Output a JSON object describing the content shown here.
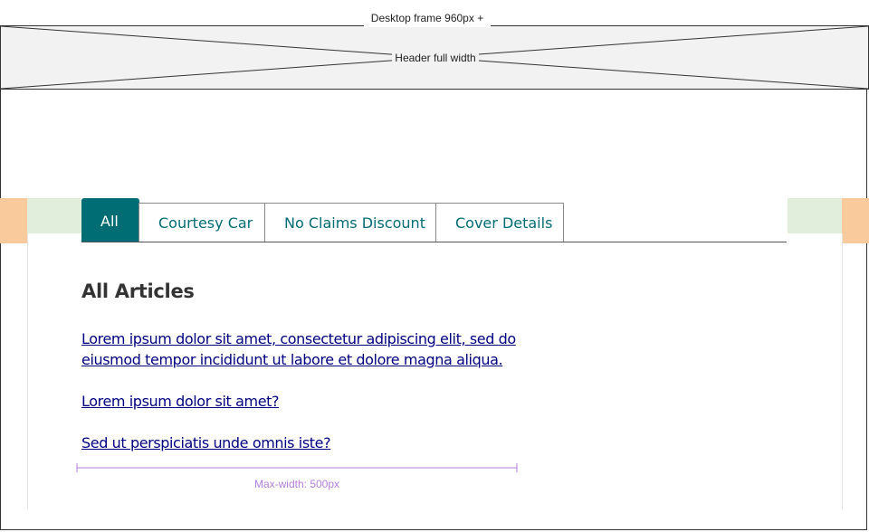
{
  "frame_label": "Desktop frame 960px +",
  "header": {
    "label": "Header full width"
  },
  "tabs": [
    {
      "label": "All",
      "active": true
    },
    {
      "label": "Courtesy Car",
      "active": false
    },
    {
      "label": "No Claims Discount",
      "active": false
    },
    {
      "label": "Cover Details",
      "active": false
    }
  ],
  "main": {
    "title": "All Articles",
    "articles": [
      {
        "text": "Lorem ipsum dolor sit amet, consectetur adipiscing elit, sed do eiusmod tempor incididunt ut labore et dolore magna aliqua."
      },
      {
        "text": "Lorem ipsum dolor sit amet?"
      },
      {
        "text": "Sed ut perspiciatis unde omnis iste?"
      }
    ]
  },
  "annotation": {
    "label": "Max-width: 500px"
  },
  "colors": {
    "tab_active_bg": "#006c73",
    "tab_text": "#006c73",
    "link": "#000080",
    "margin_orange": "#f9cb9c",
    "margin_green": "#e0eedb",
    "annotation": "#b57edc"
  }
}
